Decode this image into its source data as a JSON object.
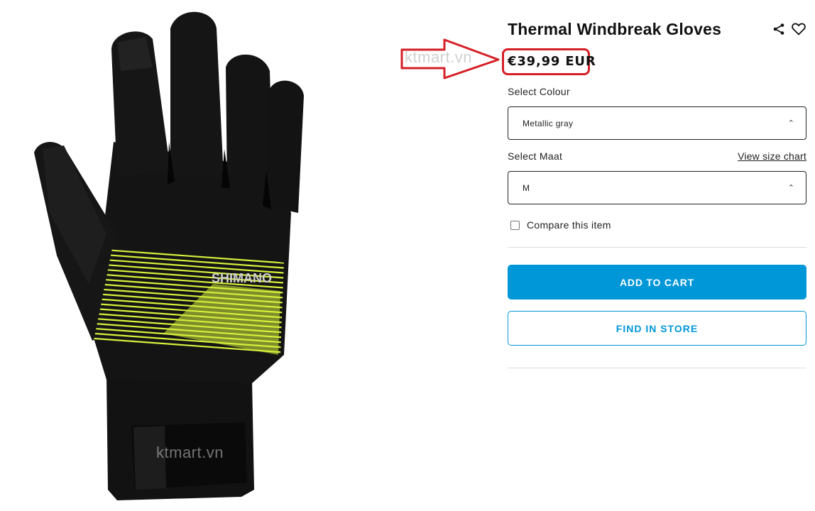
{
  "product": {
    "title": "Thermal Windbreak Gloves",
    "price": "€39,99 EUR",
    "image_alt": "glove-image",
    "brand_print": "SHIMANO"
  },
  "actions": {
    "share_icon": "share-icon",
    "wishlist_icon": "heart-icon"
  },
  "colour": {
    "label": "Select Colour",
    "selected": "Metallic gray"
  },
  "size": {
    "label": "Select Maat",
    "selected": "M",
    "size_chart_link": "View size chart"
  },
  "compare": {
    "label": "Compare this item",
    "checked": false
  },
  "buttons": {
    "add_to_cart": "ADD TO CART",
    "find_in_store": "FIND IN STORE"
  },
  "watermarks": {
    "top": "ktmart.vn",
    "bottom": "ktmart.vn"
  },
  "colors": {
    "accent": "#0097d8",
    "highlight": "#d61f26",
    "glove_black": "#141414",
    "glove_stripe": "#d7f03c"
  }
}
